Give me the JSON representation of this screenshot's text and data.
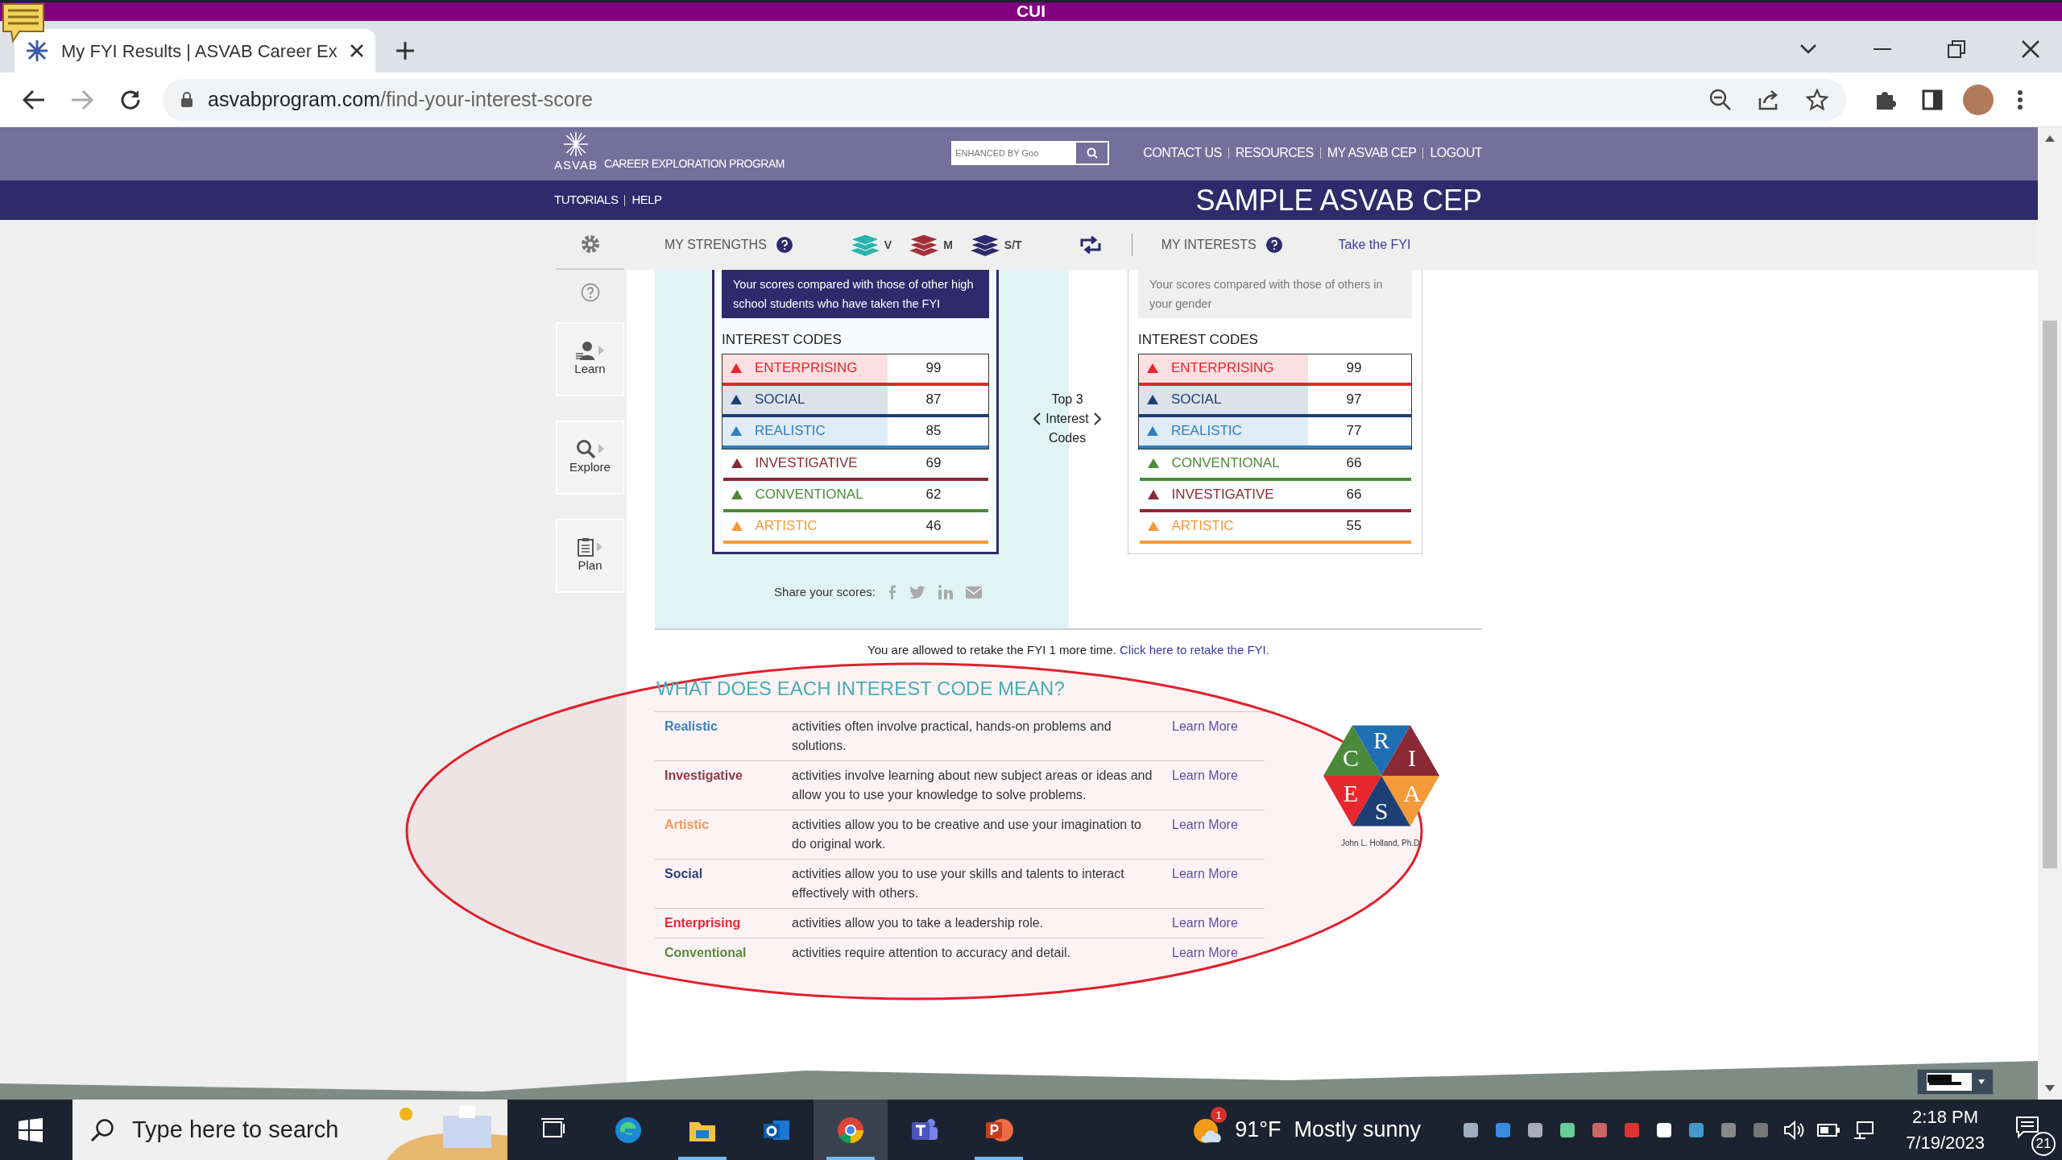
{
  "classification_banner": "CUI",
  "browser": {
    "tabs": [
      {
        "title": "My FYI Results | ASVAB Career Ex",
        "selected": true
      }
    ],
    "url_host": "asvabprogram.com",
    "url_path": "/find-your-interest-score"
  },
  "site_header": {
    "logo_text": "ASVAB",
    "program_name": "CAREER EXPLORATION PROGRAM",
    "search_placeholder": "ENHANCED BY Goo",
    "nav_links": [
      "CONTACT US",
      "RESOURCES",
      "MY ASVAB CEP",
      "LOGOUT"
    ],
    "sub_nav": [
      "TUTORIALS",
      "HELP"
    ],
    "site_title": "SAMPLE ASVAB CEP"
  },
  "toolbar": {
    "strengths_label": "MY STRENGTHS",
    "strengths": [
      {
        "label": "V",
        "color": "#2fb3ad"
      },
      {
        "label": "M",
        "color": "#a3303a"
      },
      {
        "label": "S/T",
        "color": "#2e2a6b"
      }
    ],
    "interests_label": "MY INTERESTS",
    "take_link": "Take the FYI"
  },
  "sidebar": {
    "items": [
      {
        "kind": "settings"
      },
      {
        "kind": "help"
      },
      {
        "kind": "learn",
        "label": "Learn"
      },
      {
        "kind": "explore",
        "label": "Explore"
      },
      {
        "kind": "plan",
        "label": "Plan"
      }
    ]
  },
  "score_panels": [
    {
      "selected": true,
      "caption": "Your scores compared with those of other high school students who have taken the FYI",
      "heading": "INTEREST CODES",
      "codes": [
        {
          "name": "ENTERPRISING",
          "score": "99",
          "color": "#e8262e",
          "top3": true
        },
        {
          "name": "SOCIAL",
          "score": "87",
          "color": "#1d3f73",
          "top3": true
        },
        {
          "name": "REALISTIC",
          "score": "85",
          "color": "#2f7fc1",
          "top3": true
        },
        {
          "name": "INVESTIGATIVE",
          "score": "69",
          "color": "#8a2a35",
          "top3": false
        },
        {
          "name": "CONVENTIONAL",
          "score": "62",
          "color": "#4a8a3a",
          "top3": false
        },
        {
          "name": "ARTISTIC",
          "score": "46",
          "color": "#f39a3a",
          "top3": false
        }
      ]
    },
    {
      "selected": false,
      "caption": "Your scores compared with those of others in your gender",
      "heading": "INTEREST CODES",
      "codes": [
        {
          "name": "ENTERPRISING",
          "score": "99",
          "color": "#e8262e",
          "top3": true
        },
        {
          "name": "SOCIAL",
          "score": "97",
          "color": "#1d3f73",
          "top3": true
        },
        {
          "name": "REALISTIC",
          "score": "77",
          "color": "#2f7fc1",
          "top3": true
        },
        {
          "name": "CONVENTIONAL",
          "score": "66",
          "color": "#4a8a3a",
          "top3": false
        },
        {
          "name": "INVESTIGATIVE",
          "score": "66",
          "color": "#8a2a35",
          "top3": false
        },
        {
          "name": "ARTISTIC",
          "score": "55",
          "color": "#f39a3a",
          "top3": false
        }
      ]
    }
  ],
  "top3_label": "Top 3 Interest Codes",
  "share_label": "Share your scores:",
  "retake": {
    "text": "You are allowed to retake the FYI 1 more time.",
    "link": "Click here to retake the FYI."
  },
  "meanings": {
    "title": "WHAT DOES EACH INTEREST CODE MEAN?",
    "rows": [
      {
        "code": "Realistic",
        "color": "#3a7ec0",
        "description": "activities often involve practical, hands-on problems and solutions.",
        "link": "Learn More"
      },
      {
        "code": "Investigative",
        "color": "#8a3a48",
        "description": "activities involve learning about new subject areas or ideas and allow you to use your knowledge to solve problems.",
        "link": "Learn More"
      },
      {
        "code": "Artistic",
        "color": "#f39a5a",
        "description": "activities allow you to be creative and use your imagination to do original work.",
        "link": "Learn More"
      },
      {
        "code": "Social",
        "color": "#2e3f73",
        "description": "activities allow you to use your skills and talents to interact effectively with others.",
        "link": "Learn More"
      },
      {
        "code": "Enterprising",
        "color": "#e8262e",
        "description": "activities allow you to take a leadership role.",
        "link": "Learn More"
      },
      {
        "code": "Conventional",
        "color": "#5a8a3a",
        "description": "activities require attention to accuracy and detail.",
        "link": "Learn More"
      }
    ]
  },
  "holland_logo": {
    "letters": [
      "R",
      "I",
      "A",
      "S",
      "E",
      "C"
    ],
    "caption": "John L. Holland, Ph.D."
  },
  "taskbar": {
    "search_placeholder": "Type here to search",
    "apps": [
      {
        "kind": "taskview",
        "running": false,
        "selected": false
      },
      {
        "kind": "edge",
        "running": false,
        "selected": false
      },
      {
        "kind": "explorer",
        "running": true,
        "selected": false
      },
      {
        "kind": "outlook",
        "running": false,
        "selected": false
      },
      {
        "kind": "chrome",
        "running": true,
        "selected": true
      },
      {
        "kind": "teams",
        "running": false,
        "selected": false
      },
      {
        "kind": "powerpoint",
        "running": true,
        "selected": false
      }
    ],
    "weather": {
      "badge": "1",
      "temperature": "91°F",
      "condition": "Mostly sunny"
    },
    "time": "2:18 PM",
    "date": "7/19/2023",
    "notification_count": "21"
  }
}
